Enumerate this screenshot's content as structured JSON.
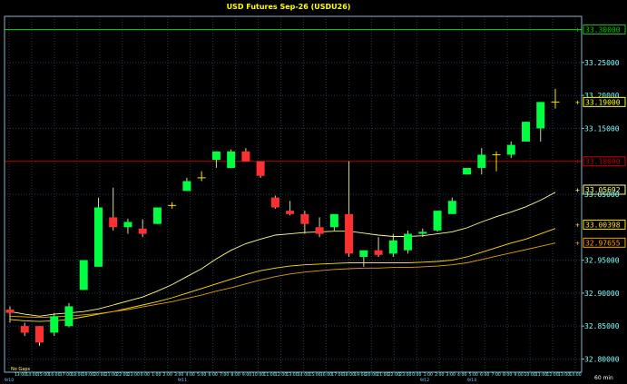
{
  "chart_data": {
    "type": "candlestick",
    "title": "USD Futures  Sep-26  (USDU26)",
    "timeframe_label": "60  min",
    "gaps_label": "No  Gaps",
    "ylim": [
      32.78,
      33.32
    ],
    "y_ticks": [
      {
        "value": 33.3,
        "label": "33.30000",
        "boxed": true,
        "color": "#00c800"
      },
      {
        "value": 33.25,
        "label": "33.25000"
      },
      {
        "value": 33.2,
        "label": "33.20000"
      },
      {
        "value": 33.19,
        "label": "33.19000",
        "boxed": true,
        "color": "#ffff00"
      },
      {
        "value": 33.15,
        "label": "33.15000"
      },
      {
        "value": 33.1,
        "label": "33.10000",
        "boxed": true,
        "color": "#c00000"
      },
      {
        "value": 33.05692,
        "label": "33.05692",
        "boxed": true,
        "color": "#ffff80"
      },
      {
        "value": 33.05,
        "label": "33.05000"
      },
      {
        "value": 33.00398,
        "label": "33.00398",
        "boxed": true,
        "color": "#ffe000"
      },
      {
        "value": 32.97655,
        "label": "32.97655",
        "boxed": true,
        "color": "#ffa000"
      },
      {
        "value": 32.95,
        "label": "32.95000"
      },
      {
        "value": 32.9,
        "label": "32.90000"
      },
      {
        "value": 32.85,
        "label": "32.85000"
      },
      {
        "value": 32.8,
        "label": "32.80000"
      }
    ],
    "x_labels": [
      "9/10",
      "13:00",
      "14:00",
      "15:00",
      "16:00",
      "17:00",
      "18:00",
      "19:00",
      "20:00",
      "21:00",
      "22:00",
      "23:00",
      "0:00",
      "1:00",
      "2:00",
      "3:00",
      "4:00",
      "5:00",
      "6:00",
      "7:00",
      "8:00",
      "9:00",
      "10:00",
      "11:00",
      "12:00",
      "13:00",
      "14:00",
      "15:00",
      "16:00",
      "17:00",
      "18:00",
      "19:00",
      "20:00",
      "21:00",
      "22:00",
      "23:00",
      "0:00",
      "1:00",
      "2:00",
      "3:00",
      "4:00",
      "5:00",
      "6:00",
      "7:00",
      "8:00",
      "9:00",
      "10:00",
      "11:00",
      "12:00",
      "13:00",
      "14:00"
    ],
    "date_markers": [
      "9/10",
      "9/11",
      "9/12",
      "9/14"
    ],
    "horizontal_lines": [
      {
        "value": 33.3,
        "color": "#00c800"
      },
      {
        "value": 33.1,
        "color": "#c00000"
      }
    ],
    "candles": [
      {
        "o": 32.875,
        "h": 32.88,
        "l": 32.855,
        "c": 32.87
      },
      {
        "o": 32.85,
        "h": 32.855,
        "l": 32.835,
        "c": 32.84
      },
      {
        "o": 32.85,
        "h": 32.85,
        "l": 32.82,
        "c": 32.825
      },
      {
        "o": 32.84,
        "h": 32.87,
        "l": 32.835,
        "c": 32.865
      },
      {
        "o": 32.85,
        "h": 32.885,
        "l": 32.848,
        "c": 32.88
      },
      {
        "o": 32.905,
        "h": 32.95,
        "l": 32.905,
        "c": 32.95
      },
      {
        "o": 32.94,
        "h": 33.045,
        "l": 32.94,
        "c": 33.03
      },
      {
        "o": 33.015,
        "h": 33.06,
        "l": 32.995,
        "c": 33.0
      },
      {
        "o": 33.0,
        "h": 33.013,
        "l": 32.99,
        "c": 33.008
      },
      {
        "o": 32.998,
        "h": 33.012,
        "l": 32.985,
        "c": 32.99
      },
      {
        "o": 33.005,
        "h": 33.03,
        "l": 33.005,
        "c": 33.03
      },
      {
        "o": 33.033,
        "h": 33.038,
        "l": 33.028,
        "c": 33.033
      },
      {
        "o": 33.055,
        "h": 33.075,
        "l": 33.055,
        "c": 33.07
      },
      {
        "o": 33.075,
        "h": 33.085,
        "l": 33.07,
        "c": 33.075
      },
      {
        "o": 33.102,
        "h": 33.115,
        "l": 33.09,
        "c": 33.115
      },
      {
        "o": 33.09,
        "h": 33.118,
        "l": 33.09,
        "c": 33.115
      },
      {
        "o": 33.115,
        "h": 33.12,
        "l": 33.1,
        "c": 33.1
      },
      {
        "o": 33.1,
        "h": 33.1,
        "l": 33.075,
        "c": 33.078
      },
      {
        "o": 33.045,
        "h": 33.048,
        "l": 33.028,
        "c": 33.03
      },
      {
        "o": 33.025,
        "h": 33.04,
        "l": 33.018,
        "c": 33.02
      },
      {
        "o": 33.02,
        "h": 33.025,
        "l": 32.99,
        "c": 33.005
      },
      {
        "o": 33.0,
        "h": 33.015,
        "l": 32.985,
        "c": 32.99
      },
      {
        "o": 33.0,
        "h": 33.02,
        "l": 32.995,
        "c": 33.02
      },
      {
        "o": 33.02,
        "h": 33.1,
        "l": 32.955,
        "c": 32.96
      },
      {
        "o": 32.955,
        "h": 32.965,
        "l": 32.94,
        "c": 32.965
      },
      {
        "o": 32.965,
        "h": 32.985,
        "l": 32.955,
        "c": 32.958
      },
      {
        "o": 32.96,
        "h": 32.99,
        "l": 32.955,
        "c": 32.98
      },
      {
        "o": 32.965,
        "h": 32.995,
        "l": 32.96,
        "c": 32.99
      },
      {
        "o": 32.99,
        "h": 32.998,
        "l": 32.985,
        "c": 32.993
      },
      {
        "o": 32.995,
        "h": 33.025,
        "l": 32.993,
        "c": 33.025
      },
      {
        "o": 33.02,
        "h": 33.045,
        "l": 33.02,
        "c": 33.04
      },
      {
        "o": 33.08,
        "h": 33.09,
        "l": 33.08,
        "c": 33.09
      },
      {
        "o": 33.09,
        "h": 33.12,
        "l": 33.08,
        "c": 33.11
      },
      {
        "o": 33.11,
        "h": 33.115,
        "l": 33.085,
        "c": 33.11
      },
      {
        "o": 33.11,
        "h": 33.13,
        "l": 33.105,
        "c": 33.125
      },
      {
        "o": 33.13,
        "h": 33.16,
        "l": 33.13,
        "c": 33.16
      },
      {
        "o": 33.15,
        "h": 33.19,
        "l": 33.13,
        "c": 33.19
      },
      {
        "o": 33.19,
        "h": 33.21,
        "l": 33.18,
        "c": 33.19
      }
    ],
    "moving_averages": [
      {
        "color": "#ffff88",
        "values": [
          32.872,
          32.868,
          32.865,
          32.868,
          32.87,
          32.872,
          32.876,
          32.882,
          32.888,
          32.894,
          32.903,
          32.913,
          32.925,
          32.937,
          32.952,
          32.965,
          32.975,
          32.982,
          32.988,
          32.99,
          32.992,
          32.993,
          32.994,
          32.994,
          32.991,
          32.988,
          32.986,
          32.986,
          32.987,
          32.99,
          32.993,
          32.999,
          33.008,
          33.016,
          33.023,
          33.031,
          33.041,
          33.053
        ]
      },
      {
        "color": "#ffe000",
        "values": [
          32.86,
          32.858,
          32.857,
          32.858,
          32.86,
          32.864,
          32.868,
          32.872,
          32.877,
          32.882,
          32.887,
          32.893,
          32.9,
          32.907,
          32.914,
          32.921,
          32.928,
          32.934,
          32.938,
          32.941,
          32.943,
          32.944,
          32.945,
          32.946,
          32.946,
          32.946,
          32.946,
          32.946,
          32.947,
          32.948,
          32.95,
          32.955,
          32.962,
          32.969,
          32.976,
          32.982,
          32.99,
          32.998
        ]
      },
      {
        "color": "#e0a000",
        "values": [
          32.865,
          32.864,
          32.863,
          32.864,
          32.865,
          32.867,
          32.869,
          32.872,
          32.875,
          32.879,
          32.883,
          32.887,
          32.892,
          32.897,
          32.903,
          32.908,
          32.914,
          32.92,
          32.925,
          32.929,
          32.932,
          32.934,
          32.936,
          32.937,
          32.938,
          32.938,
          32.939,
          32.939,
          32.94,
          32.941,
          32.943,
          32.946,
          32.951,
          32.956,
          32.961,
          32.966,
          32.971,
          32.976
        ]
      }
    ],
    "colors": {
      "up": "#00ff40",
      "down": "#ff3030",
      "doji": "#ffe000",
      "grid": "#1e3a50",
      "axis_text": "#80ffff",
      "background": "#000000",
      "frame": "#8ab4c8"
    }
  }
}
